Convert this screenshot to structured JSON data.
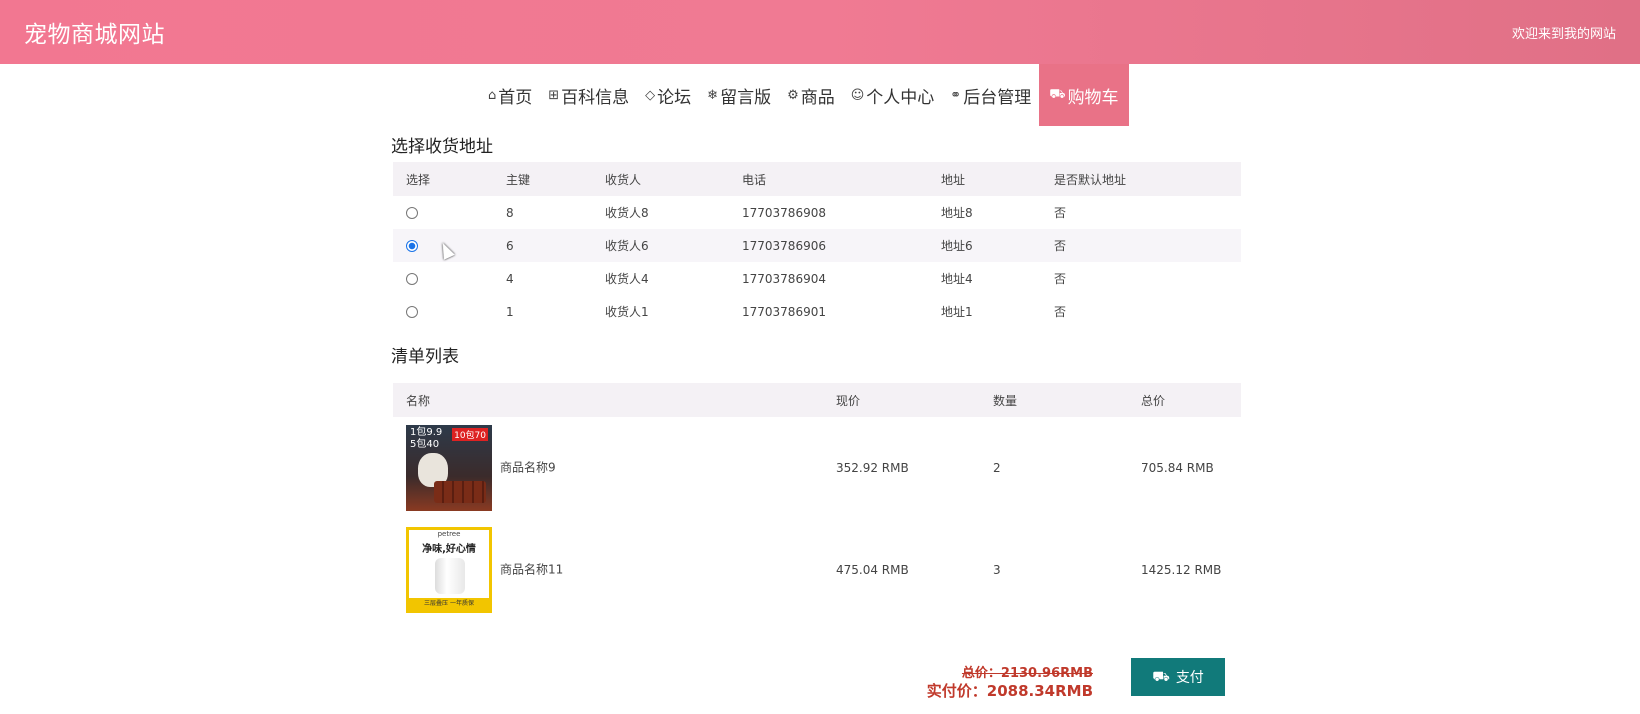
{
  "header": {
    "site_title": "宠物商城网站",
    "welcome": "欢迎来到我的网站"
  },
  "nav": {
    "items": [
      {
        "label": "首页",
        "icon": "home-icon",
        "glyph": "⌂"
      },
      {
        "label": "百科信息",
        "icon": "grid-icon",
        "glyph": "⊞"
      },
      {
        "label": "论坛",
        "icon": "tag-icon",
        "glyph": "◇"
      },
      {
        "label": "留言版",
        "icon": "snowflake-icon",
        "glyph": "❄"
      },
      {
        "label": "商品",
        "icon": "gear-icon",
        "glyph": "⚙"
      },
      {
        "label": "个人中心",
        "icon": "user-icon",
        "glyph": "☺"
      },
      {
        "label": "后台管理",
        "icon": "link-icon",
        "glyph": "⚭"
      },
      {
        "label": "购物车",
        "icon": "cart-icon",
        "glyph": "⛟",
        "active": true
      }
    ]
  },
  "address": {
    "title": "选择收货地址",
    "columns": [
      "选择",
      "主键",
      "收货人",
      "电话",
      "地址",
      "是否默认地址"
    ],
    "rows": [
      {
        "id": "8",
        "name": "收货人8",
        "phone": "17703786908",
        "addr": "地址8",
        "default": "否",
        "selected": false
      },
      {
        "id": "6",
        "name": "收货人6",
        "phone": "17703786906",
        "addr": "地址6",
        "default": "否",
        "selected": true
      },
      {
        "id": "4",
        "name": "收货人4",
        "phone": "17703786904",
        "addr": "地址4",
        "default": "否",
        "selected": false
      },
      {
        "id": "1",
        "name": "收货人1",
        "phone": "17703786901",
        "addr": "地址1",
        "default": "否",
        "selected": false
      }
    ]
  },
  "cart": {
    "title": "清单列表",
    "columns": [
      "名称",
      "现价",
      "数量",
      "总价"
    ],
    "rows": [
      {
        "name": "商品名称9",
        "price": "352.92 RMB",
        "qty": "2",
        "total": "705.84 RMB",
        "img_text": "1包9.9\n5包40",
        "img_tag": "10包70"
      },
      {
        "name": "商品名称11",
        "price": "475.04 RMB",
        "qty": "3",
        "total": "1425.12 RMB",
        "img_brand": "petree",
        "img_slogan": "净味,好心情",
        "img_foot": "三层叠压 一年质保"
      }
    ]
  },
  "summary": {
    "old_total": "总价：2130.96RMB",
    "real_total": "实付价：2088.34RMB",
    "pay_label": "支付"
  }
}
